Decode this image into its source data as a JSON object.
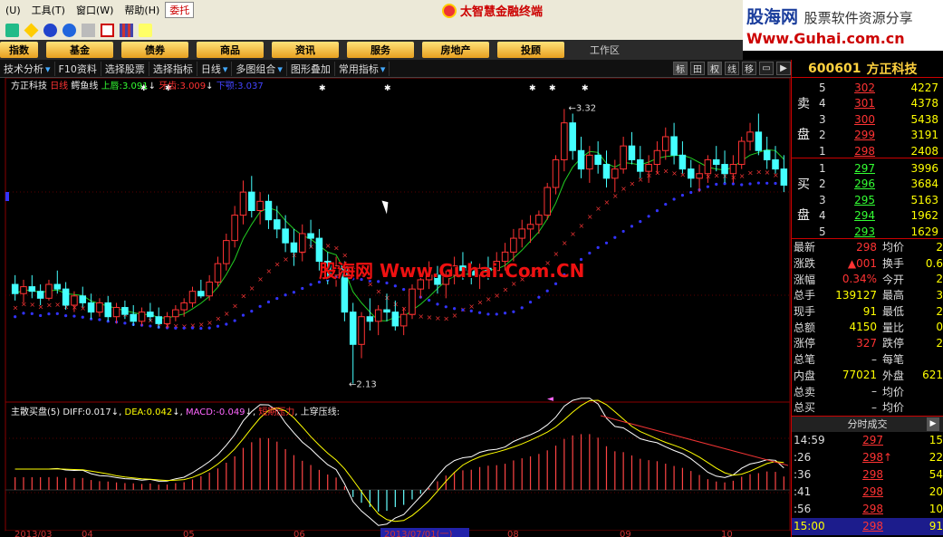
{
  "menu": {
    "items": [
      "(U)",
      "工具(T)",
      "窗口(W)",
      "帮助(H)"
    ],
    "active": "委托"
  },
  "app_title": "太智慧金融终端",
  "brand": {
    "line1_a": "股海网",
    "line1_b": "股票软件资源分享",
    "line2": "Www.Guhai.com.cn"
  },
  "categories": [
    "指数",
    "基金",
    "债券",
    "商品",
    "资讯",
    "服务",
    "房地产",
    "投顾"
  ],
  "workspace_label": "工作区",
  "funcbar": {
    "items": [
      "技术分析",
      "F10资料",
      "选择股票",
      "选择指标",
      "日线",
      "多图组合",
      "图形叠加",
      "常用指标"
    ],
    "view_buttons": [
      "标",
      "田",
      "权",
      "线",
      "移"
    ]
  },
  "stock": {
    "code": "600601",
    "name": "方正科技"
  },
  "indicator1": {
    "stock": "方正科技",
    "period": "日线",
    "name": "鳄鱼线",
    "upper_label": "上唇:",
    "upper_val": "3.091",
    "teeth_label": "牙齿:",
    "teeth_val": "3.009",
    "lower_label": "下颚:",
    "lower_val": "3.037"
  },
  "indicator2": {
    "name": "主散买盘(5)",
    "diff_label": "DIFF:",
    "diff_val": "0.017",
    "dea_label": "DEA:",
    "dea_val": "0.042",
    "macd_label": "MACD:",
    "macd_val": "-0.049",
    "short_label": "短期压力",
    "long_label": "上穿压线:"
  },
  "chart_data": {
    "type": "candlestick",
    "price_annotations": [
      {
        "label": "3.32",
        "price": 3.32
      },
      {
        "label": "2.13",
        "price": 2.13
      }
    ],
    "x_labels": [
      "2013/03",
      "04",
      "05",
      "06",
      "2013/07/01(一)",
      "08",
      "09",
      "10"
    ],
    "candles": [
      [
        2.56,
        2.6,
        2.49,
        2.52
      ],
      [
        2.52,
        2.58,
        2.48,
        2.55
      ],
      [
        2.55,
        2.6,
        2.5,
        2.53
      ],
      [
        2.53,
        2.56,
        2.47,
        2.5
      ],
      [
        2.5,
        2.58,
        2.49,
        2.56
      ],
      [
        2.56,
        2.62,
        2.52,
        2.54
      ],
      [
        2.54,
        2.57,
        2.45,
        2.47
      ],
      [
        2.47,
        2.53,
        2.44,
        2.51
      ],
      [
        2.51,
        2.55,
        2.46,
        2.48
      ],
      [
        2.48,
        2.52,
        2.41,
        2.44
      ],
      [
        2.44,
        2.5,
        2.42,
        2.48
      ],
      [
        2.48,
        2.51,
        2.4,
        2.42
      ],
      [
        2.42,
        2.48,
        2.39,
        2.46
      ],
      [
        2.46,
        2.49,
        2.41,
        2.43
      ],
      [
        2.43,
        2.47,
        2.38,
        2.4
      ],
      [
        2.4,
        2.46,
        2.38,
        2.44
      ],
      [
        2.44,
        2.48,
        2.4,
        2.42
      ],
      [
        2.42,
        2.46,
        2.37,
        2.39
      ],
      [
        2.39,
        2.44,
        2.37,
        2.42
      ],
      [
        2.42,
        2.47,
        2.4,
        2.45
      ],
      [
        2.45,
        2.5,
        2.42,
        2.48
      ],
      [
        2.48,
        2.55,
        2.46,
        2.53
      ],
      [
        2.53,
        2.58,
        2.5,
        2.51
      ],
      [
        2.51,
        2.6,
        2.49,
        2.57
      ],
      [
        2.57,
        2.68,
        2.55,
        2.65
      ],
      [
        2.65,
        2.78,
        2.62,
        2.75
      ],
      [
        2.75,
        2.9,
        2.72,
        2.86
      ],
      [
        2.86,
        3.01,
        2.82,
        2.96
      ],
      [
        2.96,
        3.03,
        2.85,
        2.88
      ],
      [
        2.88,
        2.96,
        2.82,
        2.92
      ],
      [
        2.92,
        2.95,
        2.8,
        2.84
      ],
      [
        2.84,
        2.9,
        2.76,
        2.8
      ],
      [
        2.8,
        2.86,
        2.7,
        2.74
      ],
      [
        2.74,
        2.8,
        2.64,
        2.7
      ],
      [
        2.7,
        2.82,
        2.66,
        2.78
      ],
      [
        2.78,
        2.84,
        2.72,
        2.76
      ],
      [
        2.76,
        2.8,
        2.62,
        2.66
      ],
      [
        2.66,
        2.7,
        2.56,
        2.6
      ],
      [
        2.6,
        2.68,
        2.55,
        2.64
      ],
      [
        2.64,
        2.66,
        2.4,
        2.44
      ],
      [
        2.44,
        2.48,
        2.13,
        2.3
      ],
      [
        2.3,
        2.44,
        2.24,
        2.42
      ],
      [
        2.42,
        2.5,
        2.36,
        2.4
      ],
      [
        2.4,
        2.47,
        2.34,
        2.45
      ],
      [
        2.45,
        2.52,
        2.4,
        2.44
      ],
      [
        2.44,
        2.49,
        2.36,
        2.38
      ],
      [
        2.38,
        2.46,
        2.34,
        2.43
      ],
      [
        2.43,
        2.56,
        2.41,
        2.54
      ],
      [
        2.54,
        2.62,
        2.5,
        2.58
      ],
      [
        2.58,
        2.66,
        2.54,
        2.6
      ],
      [
        2.6,
        2.64,
        2.52,
        2.56
      ],
      [
        2.56,
        2.62,
        2.5,
        2.6
      ],
      [
        2.6,
        2.68,
        2.56,
        2.64
      ],
      [
        2.64,
        2.7,
        2.58,
        2.62
      ],
      [
        2.62,
        2.66,
        2.56,
        2.6
      ],
      [
        2.6,
        2.65,
        2.54,
        2.63
      ],
      [
        2.63,
        2.68,
        2.58,
        2.62
      ],
      [
        2.62,
        2.7,
        2.6,
        2.66
      ],
      [
        2.66,
        2.74,
        2.62,
        2.7
      ],
      [
        2.7,
        2.8,
        2.66,
        2.76
      ],
      [
        2.76,
        2.84,
        2.72,
        2.8
      ],
      [
        2.8,
        2.86,
        2.74,
        2.82
      ],
      [
        2.82,
        2.88,
        2.78,
        2.86
      ],
      [
        2.86,
        3.0,
        2.84,
        2.98
      ],
      [
        2.98,
        3.12,
        2.95,
        3.1
      ],
      [
        3.1,
        3.32,
        3.05,
        3.26
      ],
      [
        3.26,
        3.3,
        3.1,
        3.14
      ],
      [
        3.14,
        3.2,
        3.02,
        3.06
      ],
      [
        3.06,
        3.16,
        3.0,
        3.12
      ],
      [
        3.12,
        3.18,
        3.04,
        3.08
      ],
      [
        3.08,
        3.14,
        2.98,
        3.02
      ],
      [
        3.02,
        3.1,
        2.96,
        3.06
      ],
      [
        3.06,
        3.2,
        3.04,
        3.16
      ],
      [
        3.16,
        3.22,
        3.08,
        3.1
      ],
      [
        3.1,
        3.16,
        3.02,
        3.05
      ],
      [
        3.05,
        3.12,
        3.0,
        3.08
      ],
      [
        3.08,
        3.18,
        3.04,
        3.14
      ],
      [
        3.14,
        3.24,
        3.1,
        3.2
      ],
      [
        3.2,
        3.26,
        3.08,
        3.12
      ],
      [
        3.12,
        3.18,
        3.04,
        3.06
      ],
      [
        3.06,
        3.1,
        2.98,
        3.02
      ],
      [
        3.02,
        3.08,
        2.96,
        3.04
      ],
      [
        3.04,
        3.12,
        3.0,
        3.1
      ],
      [
        3.1,
        3.16,
        3.05,
        3.08
      ],
      [
        3.08,
        3.14,
        3.0,
        3.04
      ],
      [
        3.04,
        3.12,
        3.0,
        3.08
      ],
      [
        3.08,
        3.2,
        3.06,
        3.18
      ],
      [
        3.18,
        3.26,
        3.14,
        3.22
      ],
      [
        3.22,
        3.3,
        3.12,
        3.14
      ],
      [
        3.14,
        3.2,
        3.06,
        3.1
      ],
      [
        3.1,
        3.16,
        3.04,
        3.06
      ],
      [
        3.06,
        3.12,
        2.96,
        2.99
      ]
    ]
  },
  "orderbook": {
    "sell_label": [
      "卖",
      "盘"
    ],
    "buy_label": [
      "买",
      "盘"
    ],
    "sell": [
      {
        "lv": "5",
        "price": "302",
        "vol": "4227"
      },
      {
        "lv": "4",
        "price": "301",
        "vol": "4378"
      },
      {
        "lv": "3",
        "price": "300",
        "vol": "5438"
      },
      {
        "lv": "2",
        "price": "299",
        "vol": "3191"
      },
      {
        "lv": "1",
        "price": "298",
        "vol": "2408"
      }
    ],
    "buy": [
      {
        "lv": "1",
        "price": "297",
        "vol": "3996"
      },
      {
        "lv": "2",
        "price": "296",
        "vol": "3684"
      },
      {
        "lv": "3",
        "price": "295",
        "vol": "5163"
      },
      {
        "lv": "4",
        "price": "294",
        "vol": "1962"
      },
      {
        "lv": "5",
        "price": "293",
        "vol": "1629"
      }
    ]
  },
  "quote": [
    {
      "k": "最新",
      "v": "298",
      "k2": "均价",
      "v2": "2"
    },
    {
      "k": "涨跌",
      "v": "▲001",
      "k2": "换手",
      "v2": "0.6"
    },
    {
      "k": "涨幅",
      "v": "0.34%",
      "k2": "今开",
      "v2": "2"
    },
    {
      "k": "总手",
      "v": "139127",
      "k2": "最高",
      "v2": "3"
    },
    {
      "k": "现手",
      "v": "91",
      "k2": "最低",
      "v2": "2"
    },
    {
      "k": "总额",
      "v": "4150",
      "k2": "量比",
      "v2": "0"
    },
    {
      "k": "涨停",
      "v": "327",
      "k2": "跌停",
      "v2": "2"
    },
    {
      "k": "总笔",
      "v": "–",
      "k2": "每笔",
      "v2": ""
    },
    {
      "k": "内盘",
      "v": "77021",
      "k2": "外盘",
      "v2": "621"
    },
    {
      "k": "总卖",
      "v": "–",
      "k2": "均价",
      "v2": ""
    },
    {
      "k": "总买",
      "v": "–",
      "k2": "均价",
      "v2": ""
    }
  ],
  "trades_header": "分时成交",
  "trades": [
    {
      "t": "14:59",
      "p": "297",
      "ar": "",
      "v": "15"
    },
    {
      "t": ":26",
      "p": "298",
      "ar": "↑",
      "v": "22"
    },
    {
      "t": ":36",
      "p": "298",
      "ar": "",
      "v": "54"
    },
    {
      "t": ":41",
      "p": "298",
      "ar": "",
      "v": "20"
    },
    {
      "t": ":56",
      "p": "298",
      "ar": "",
      "v": "10"
    },
    {
      "t": "15:00",
      "p": "298",
      "ar": "",
      "v": "91"
    }
  ],
  "watermark": "股海网 Www.Guhai.Com.CN"
}
